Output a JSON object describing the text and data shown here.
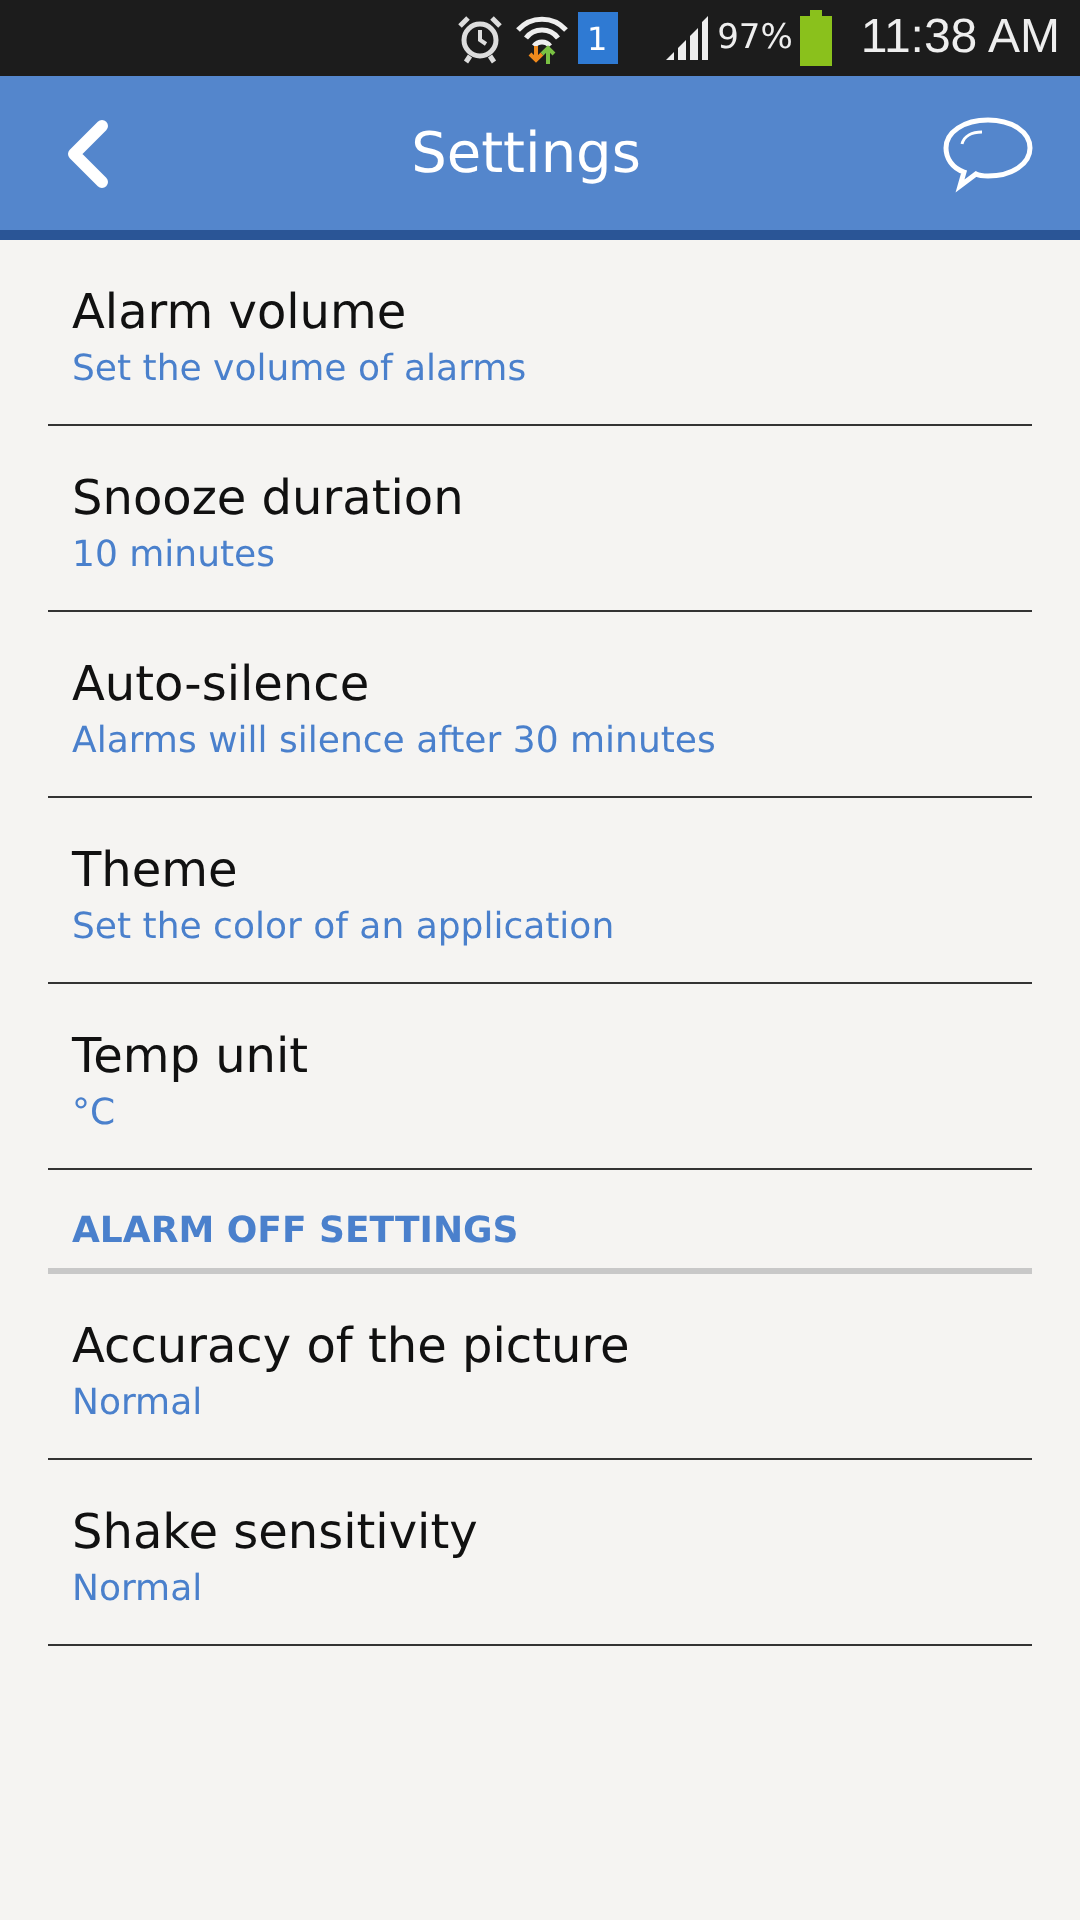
{
  "status_bar": {
    "sim_badge": "1",
    "battery": "97%",
    "time": "11:38 AM"
  },
  "header": {
    "title": "Settings"
  },
  "items": [
    {
      "kind": "setting",
      "title": "Alarm volume",
      "summary": "Set the volume of alarms"
    },
    {
      "kind": "setting",
      "title": "Snooze duration",
      "summary": "10 minutes"
    },
    {
      "kind": "setting",
      "title": "Auto-silence",
      "summary": "Alarms will silence after 30 minutes"
    },
    {
      "kind": "setting",
      "title": "Theme",
      "summary": "Set the color of an application"
    },
    {
      "kind": "setting",
      "title": "Temp unit",
      "summary": "°C"
    },
    {
      "kind": "section",
      "title": "ALARM OFF SETTINGS"
    },
    {
      "kind": "setting",
      "title": "Accuracy of the picture",
      "summary": "Normal"
    },
    {
      "kind": "setting",
      "title": "Shake sensitivity",
      "summary": "Normal"
    }
  ]
}
